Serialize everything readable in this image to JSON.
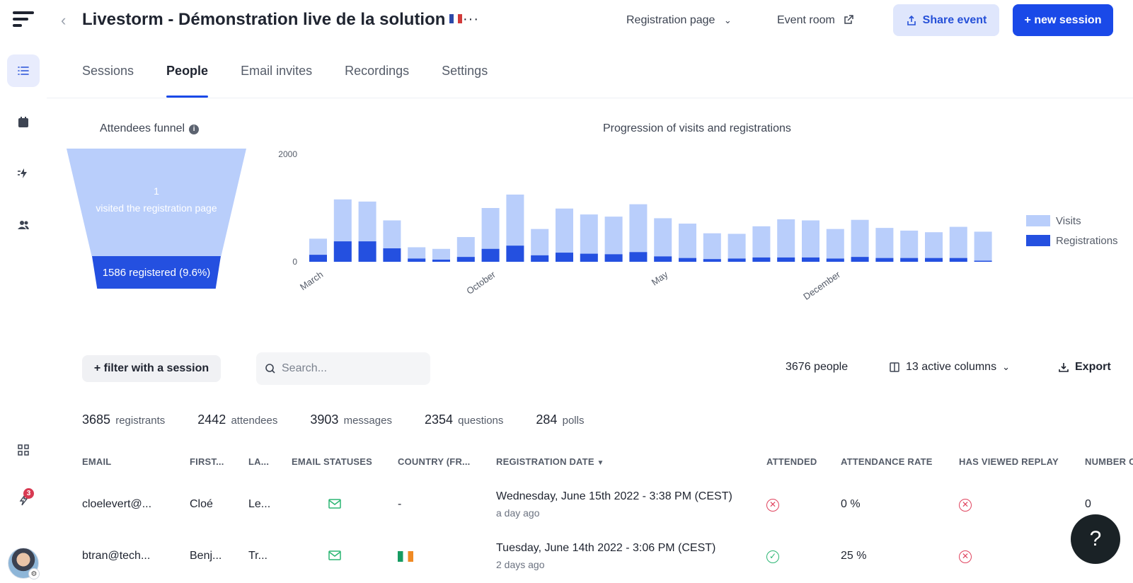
{
  "header": {
    "title": "Livestorm - Démonstration live de la solution",
    "registration_page": "Registration page",
    "event_room": "Event room",
    "share_event": "Share event",
    "new_session": "+ new session"
  },
  "sidebar": {
    "notifications_badge": "3"
  },
  "tabs": [
    "Sessions",
    "People",
    "Email invites",
    "Recordings",
    "Settings"
  ],
  "active_tab": "People",
  "funnel": {
    "title": "Attendees funnel",
    "visited_value": "1",
    "visited_label": "visited the registration page",
    "registered_label": "1586 registered (9.6%)"
  },
  "chart_data": {
    "type": "bar",
    "title": "Progression of visits and registrations",
    "y_ticks": [
      "2000",
      "0"
    ],
    "ylim": [
      0,
      2000
    ],
    "x_tick_labels": [
      "March",
      "October",
      "May",
      "December"
    ],
    "x_tick_indices": [
      0,
      7,
      14,
      21
    ],
    "series": [
      {
        "name": "Visits",
        "values": [
          430,
          1160,
          1120,
          770,
          270,
          240,
          460,
          1000,
          1250,
          610,
          990,
          880,
          840,
          1070,
          810,
          710,
          530,
          520,
          660,
          790,
          770,
          610,
          780,
          630,
          580,
          550,
          650,
          560
        ]
      },
      {
        "name": "Registrations",
        "values": [
          130,
          380,
          380,
          250,
          60,
          40,
          90,
          240,
          300,
          120,
          170,
          150,
          140,
          180,
          100,
          70,
          50,
          60,
          80,
          80,
          80,
          60,
          90,
          70,
          70,
          70,
          70,
          20
        ]
      }
    ],
    "colors": {
      "visits": "#b9cefb",
      "registrations": "#2450e0"
    },
    "legend_position": "right",
    "grid": false
  },
  "toolbar": {
    "filter_label": "+ filter with a session",
    "search_placeholder": "Search...",
    "people_count": "3676 people",
    "active_columns": "13 active columns",
    "export_label": "Export"
  },
  "stats": [
    {
      "value": "3685",
      "label": "registrants"
    },
    {
      "value": "2442",
      "label": "attendees"
    },
    {
      "value": "3903",
      "label": "messages"
    },
    {
      "value": "2354",
      "label": "questions"
    },
    {
      "value": "284",
      "label": "polls"
    }
  ],
  "table": {
    "columns": [
      "EMAIL",
      "FIRST...",
      "LA...",
      "EMAIL STATUSES",
      "COUNTRY (FR...",
      "REGISTRATION DATE",
      "ATTENDED",
      "ATTENDANCE RATE",
      "HAS VIEWED REPLAY",
      "NUMBER O"
    ],
    "rows": [
      {
        "email": "cloelevert@...",
        "first": "Cloé",
        "last": "Le...",
        "country": "-",
        "reg_date": "Wednesday, June 15th 2022 - 3:38 PM (CEST)",
        "reg_ago": "a day ago",
        "attended": false,
        "rate": "0 %",
        "replay": false,
        "number": "0"
      },
      {
        "email": "btran@tech...",
        "first": "Benj...",
        "last": "Tr...",
        "country": "",
        "reg_date": "Tuesday, June 14th 2022 - 3:06 PM (CEST)",
        "reg_ago": "2 days ago",
        "attended": true,
        "rate": "25 %",
        "replay": false,
        "number": ""
      }
    ]
  },
  "help_label": "?"
}
